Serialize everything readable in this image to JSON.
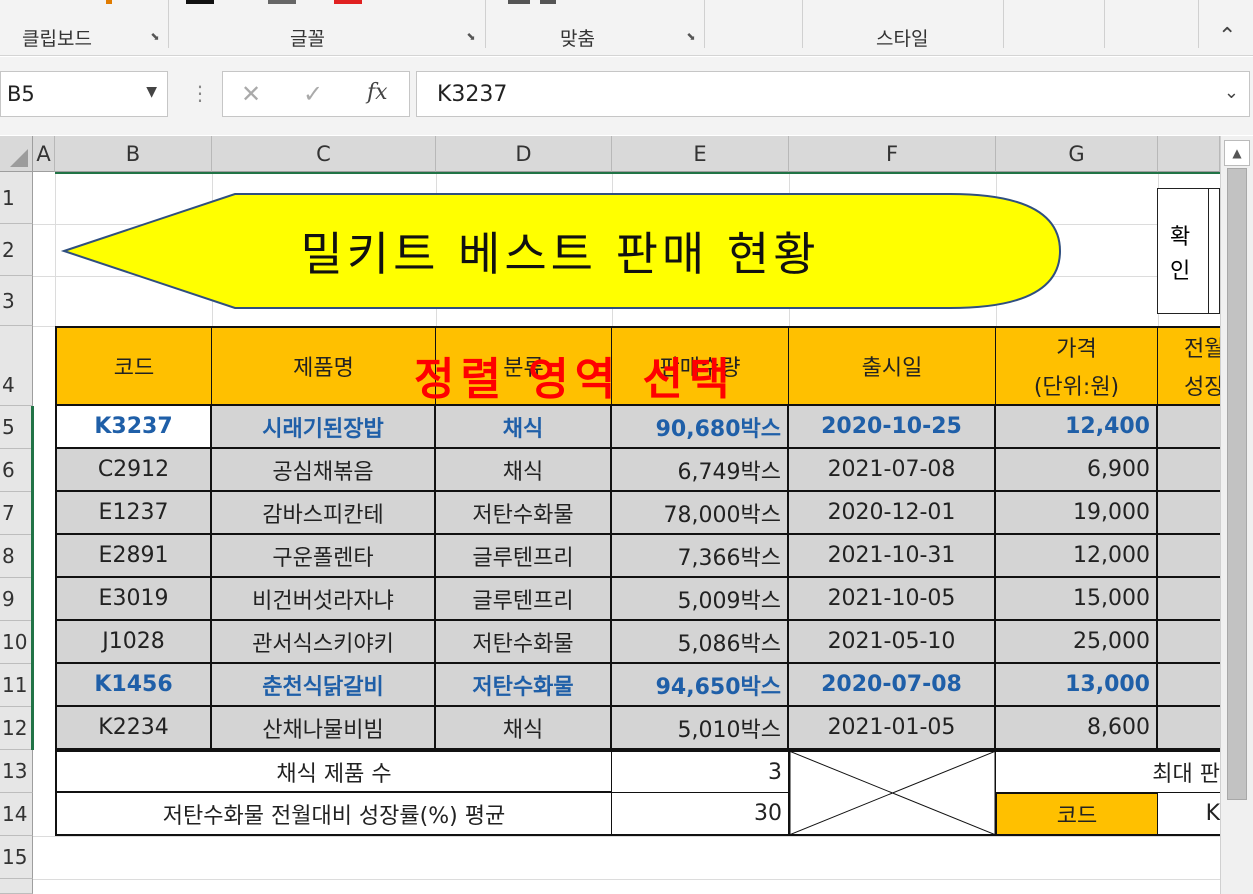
{
  "ribbon": {
    "groups": [
      "클립보드",
      "글꼴",
      "맞춤",
      "스타일"
    ]
  },
  "formula_bar": {
    "name_box": "B5",
    "content": "K3237",
    "fx": "fx"
  },
  "columns": [
    "A",
    "B",
    "C",
    "D",
    "E",
    "F",
    "G"
  ],
  "rows": [
    "1",
    "2",
    "3",
    "4",
    "5",
    "6",
    "7",
    "8",
    "9",
    "10",
    "11",
    "12",
    "13",
    "14",
    "15"
  ],
  "banner_title": "밀키트 베스트 판매 현황",
  "confirm_box": [
    "확",
    "인"
  ],
  "overlay_text": "정렬 영역 선택",
  "table_headers": [
    "코드",
    "제품명",
    "분류",
    "판매수량",
    "출시일",
    "가격",
    "(단위:원)",
    "전월",
    "성장"
  ],
  "table_rows": [
    {
      "code": "K3237",
      "name": "시래기된장밥",
      "category": "채식",
      "qty": "90,680박스",
      "date": "2020-10-25",
      "price": "12,400"
    },
    {
      "code": "C2912",
      "name": "공심채볶음",
      "category": "채식",
      "qty": "6,749박스",
      "date": "2021-07-08",
      "price": "6,900"
    },
    {
      "code": "E1237",
      "name": "감바스피칸테",
      "category": "저탄수화물",
      "qty": "78,000박스",
      "date": "2020-12-01",
      "price": "19,000"
    },
    {
      "code": "E2891",
      "name": "구운폴렌타",
      "category": "글루텐프리",
      "qty": "7,366박스",
      "date": "2021-10-31",
      "price": "12,000"
    },
    {
      "code": "E3019",
      "name": "비건버섯라자냐",
      "category": "글루텐프리",
      "qty": "5,009박스",
      "date": "2021-10-05",
      "price": "15,000"
    },
    {
      "code": "J1028",
      "name": "관서식스키야키",
      "category": "저탄수화물",
      "qty": "5,086박스",
      "date": "2021-05-10",
      "price": "25,000"
    },
    {
      "code": "K1456",
      "name": "춘천식닭갈비",
      "category": "저탄수화물",
      "qty": "94,650박스",
      "date": "2020-07-08",
      "price": "13,000"
    },
    {
      "code": "K2234",
      "name": "산채나물비빔",
      "category": "채식",
      "qty": "5,010박스",
      "date": "2021-01-05",
      "price": "8,600"
    }
  ],
  "summary": {
    "row13_label": "채식 제품 수",
    "row13_value": "3",
    "row14_label": "저탄수화물 전월대비 성장률(%) 평균",
    "row14_value": "30",
    "max_label": "최대 판",
    "code_label": "코드",
    "code_value": "K"
  }
}
